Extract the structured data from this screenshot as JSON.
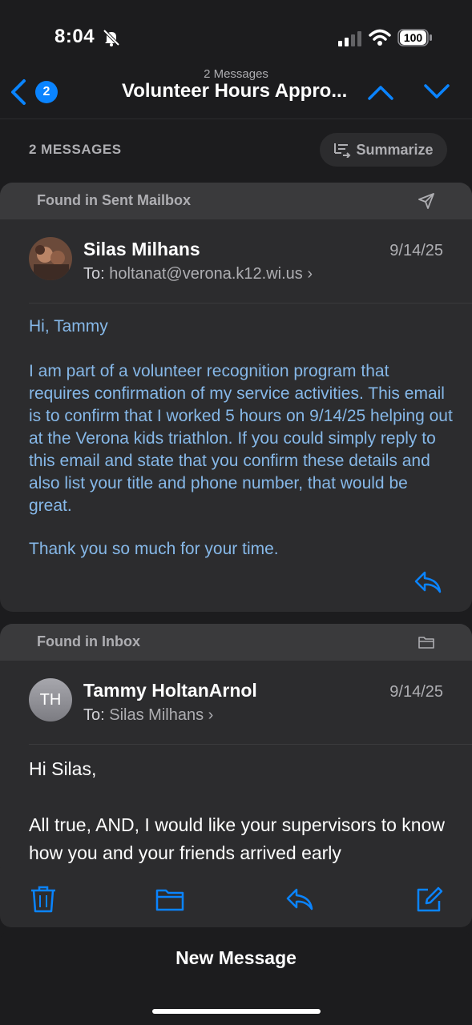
{
  "status": {
    "time": "8:04",
    "battery": "100"
  },
  "nav": {
    "badge": "2",
    "subtitle": "2 Messages",
    "title": "Volunteer Hours Appro..."
  },
  "thread": {
    "count_label": "2 MESSAGES",
    "summarize_label": "Summarize"
  },
  "message1": {
    "mailbox_label": "Found in Sent Mailbox",
    "sender": "Silas Milhans",
    "to_prefix": "To:",
    "to": "holtanat@verona.k12.wi.us",
    "date": "9/14/25",
    "greeting": "Hi, Tammy",
    "paragraph": "I am part of a volunteer recognition program that requires confirmation of my service activities. This email is to confirm that I worked 5 hours on 9/14/25 helping out at the Verona kids triathlon. If you could simply reply to this email and state that you confirm these details and also list your title and phone number, that would be great.",
    "closing": "Thank you so much for your time."
  },
  "message2": {
    "mailbox_label": "Found in Inbox",
    "initials": "TH",
    "sender": "Tammy HoltanArnol",
    "to_prefix": "To:",
    "to": "Silas Milhans",
    "date": "9/14/25",
    "greeting": "Hi Silas,",
    "paragraph": "All true, AND,  I would like your supervisors to know how you and your friends arrived early"
  },
  "footer": {
    "new_message_label": "New Message"
  },
  "colors": {
    "accent": "#0a84ff",
    "quoted_text": "#86b8e8"
  }
}
